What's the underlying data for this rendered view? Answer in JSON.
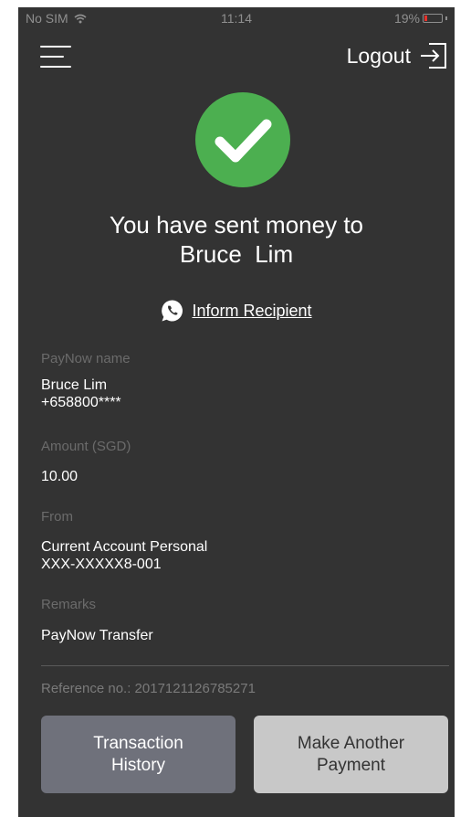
{
  "status_bar": {
    "carrier": "No SIM",
    "time": "11:14",
    "battery": "19%",
    "battery_level": 0.19,
    "battery_color": "#e8312a"
  },
  "header": {
    "menu_icon": "hamburger-menu-icon",
    "logout_label": "Logout",
    "logout_icon": "logout-icon"
  },
  "success": {
    "icon": "check-circle-icon",
    "icon_color": "#4caf50",
    "line1": "You have sent money to",
    "line2": "Bruce  Lim"
  },
  "inform": {
    "icon": "whatsapp-icon",
    "label": "Inform Recipient"
  },
  "details": {
    "paynow_name_label": "PayNow name",
    "paynow_name": "Bruce Lim",
    "paynow_number": "+658800****",
    "amount_label": "Amount (SGD)",
    "amount": "10.00",
    "from_label": "From",
    "from_account_name": "Current Account Personal",
    "from_account_number": "XXX-XXXXX8-001",
    "remarks_label": "Remarks",
    "remarks": "PayNow Transfer"
  },
  "reference": "Reference no.: 2017121126785271",
  "buttons": {
    "history_line1": "Transaction",
    "history_line2": "History",
    "another_line1": "Make Another",
    "another_line2": "Payment"
  },
  "colors": {
    "background": "#333333",
    "history_button": "#6f717b",
    "another_button": "#c8c8c8"
  }
}
